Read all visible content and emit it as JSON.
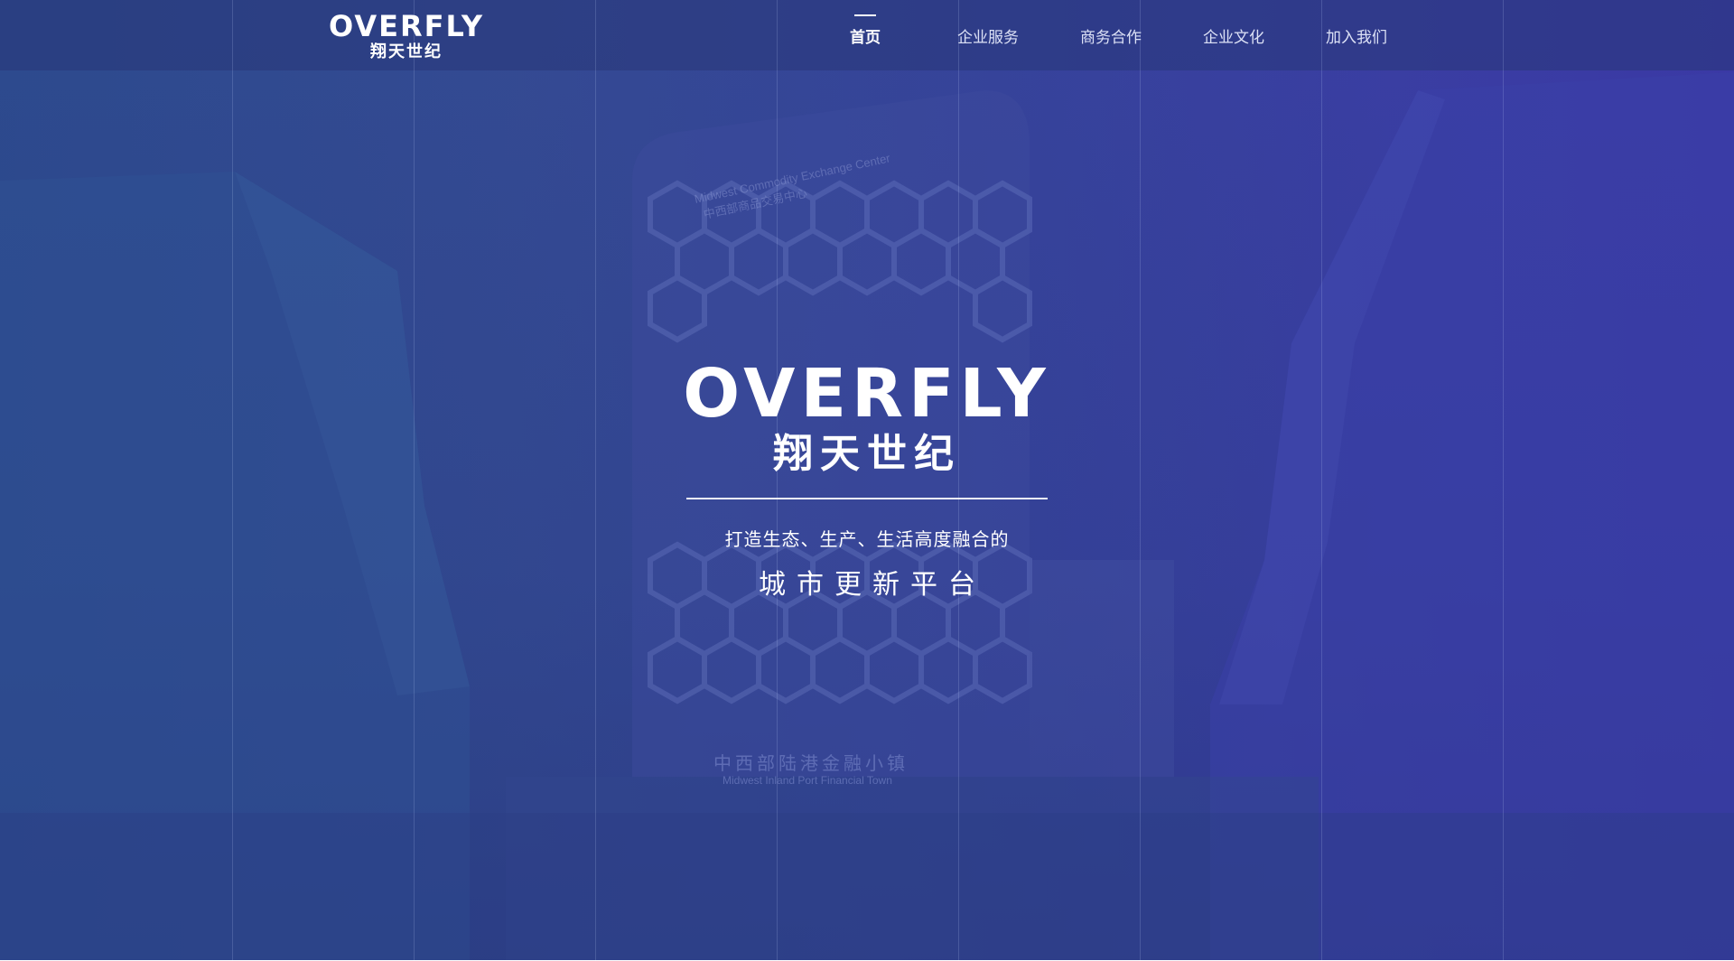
{
  "brand": {
    "name_en": "OVERFLY",
    "name_cn": "翔天世纪"
  },
  "nav": {
    "items": [
      {
        "label": "首页",
        "active": true
      },
      {
        "label": "企业服务",
        "active": false
      },
      {
        "label": "商务合作",
        "active": false
      },
      {
        "label": "企业文化",
        "active": false
      },
      {
        "label": "加入我们",
        "active": false
      }
    ]
  },
  "hero": {
    "tagline_line1": "打造生态、生产、生活高度融合的",
    "tagline_line2": "城市更新平台",
    "building_sign_cn": "中西部陆港金融小镇",
    "building_sign_en": "Midwest Inland Port Financial Town",
    "tower_sign_en": "Midwest Commodity Exchange Center",
    "tower_sign_cn": "中西部商品交易中心"
  },
  "colors": {
    "overlay_left": "#2d4a8e",
    "overlay_right": "#3b39a6",
    "text": "#ffffff"
  }
}
